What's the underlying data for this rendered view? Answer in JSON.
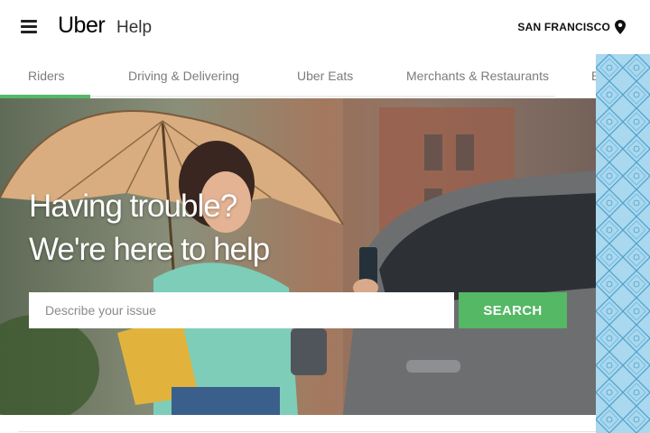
{
  "header": {
    "logo": "Uber",
    "logo_sub": "Help",
    "city": "SAN FRANCISCO",
    "menu_icon": "hamburger-menu-icon",
    "location_icon": "map-pin-icon"
  },
  "tabs": [
    {
      "label": "Riders",
      "active": true
    },
    {
      "label": "Driving & Delivering",
      "active": false
    },
    {
      "label": "Uber Eats",
      "active": false
    },
    {
      "label": "Merchants & Restaurants",
      "active": false
    },
    {
      "label": "B",
      "active": false
    }
  ],
  "hero": {
    "title": "Having trouble?",
    "subtitle": "We're here to help"
  },
  "search": {
    "placeholder": "Describe your issue",
    "value": "",
    "button_label": "SEARCH"
  },
  "colors": {
    "accent": "#54b864",
    "pattern": "#a9d8ef"
  }
}
